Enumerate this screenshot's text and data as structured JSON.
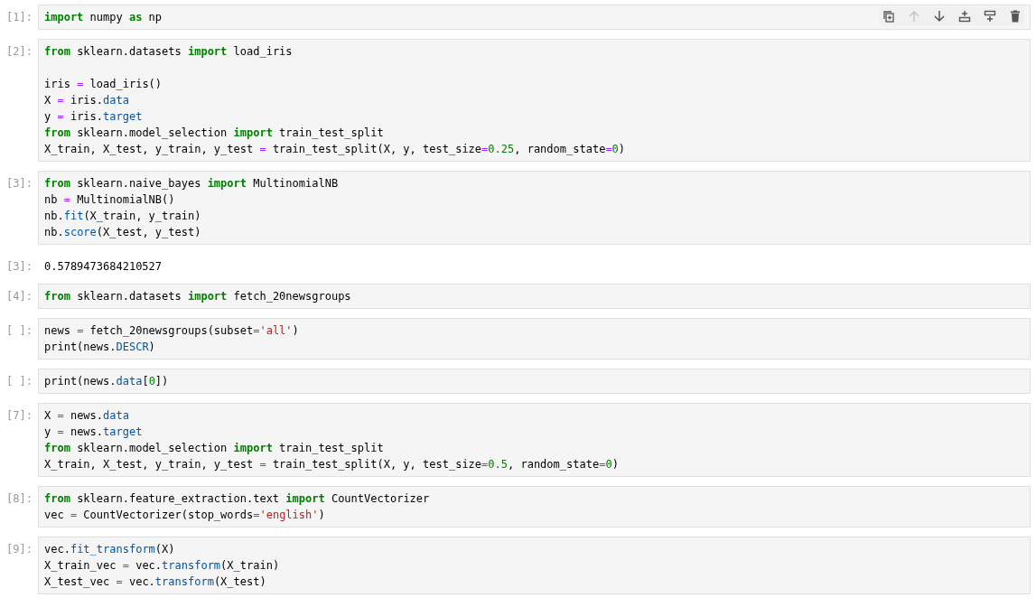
{
  "cell_toolbar": [
    {
      "kind": "duplicate",
      "disabled": false
    },
    {
      "kind": "up",
      "disabled": true
    },
    {
      "kind": "down",
      "disabled": false
    },
    {
      "kind": "insert_above",
      "disabled": false
    },
    {
      "kind": "insert_below",
      "disabled": false
    },
    {
      "kind": "delete",
      "disabled": false
    }
  ],
  "cells": [
    {
      "prompt": "[1]:",
      "selected": true,
      "lines": [
        {
          "tokens": [
            {
              "t": "import",
              "kind": "kw"
            },
            {
              "t": " numpy "
            },
            {
              "t": "as",
              "kind": "kw"
            },
            {
              "t": " np"
            }
          ]
        }
      ]
    },
    {
      "prompt": "[2]:",
      "selected": false,
      "lines": [
        {
          "tokens": [
            {
              "t": "from",
              "kind": "kw"
            },
            {
              "t": " sklearn.datasets "
            },
            {
              "t": "import",
              "kind": "kw"
            },
            {
              "t": " load_iris"
            }
          ]
        },
        {
          "blank_before": true,
          "tokens": [
            {
              "t": "iris "
            },
            {
              "t": "=",
              "kind": "op"
            },
            {
              "t": " load_iris()"
            }
          ]
        },
        {
          "tokens": [
            {
              "t": "X "
            },
            {
              "t": "=",
              "kind": "op"
            },
            {
              "t": " iris."
            },
            {
              "t": "data",
              "kind": "attr"
            }
          ]
        },
        {
          "tokens": [
            {
              "t": "y "
            },
            {
              "t": "=",
              "kind": "op"
            },
            {
              "t": " iris."
            },
            {
              "t": "target",
              "kind": "attr"
            }
          ]
        },
        {
          "tokens": [
            {
              "t": "from",
              "kind": "kw"
            },
            {
              "t": " sklearn.model_selection "
            },
            {
              "t": "import",
              "kind": "kw"
            },
            {
              "t": " train_test_split"
            }
          ]
        },
        {
          "tokens": [
            {
              "t": "X_train, X_test, y_train, y_test "
            },
            {
              "t": "=",
              "kind": "op"
            },
            {
              "t": " train_test_split(X, y, test_size"
            },
            {
              "t": "=",
              "kind": "op"
            },
            {
              "t": "0.25",
              "kind": "num"
            },
            {
              "t": ", random_state"
            },
            {
              "t": "=",
              "kind": "op"
            },
            {
              "t": "0",
              "kind": "num"
            },
            {
              "t": ")"
            }
          ]
        }
      ]
    },
    {
      "prompt": "[3]:",
      "selected": false,
      "lines": [
        {
          "tokens": [
            {
              "t": "from",
              "kind": "kw"
            },
            {
              "t": " sklearn.naive_bayes "
            },
            {
              "t": "import",
              "kind": "kw"
            },
            {
              "t": " MultinomialNB"
            }
          ]
        },
        {
          "tokens": [
            {
              "t": "nb "
            },
            {
              "t": "=",
              "kind": "op"
            },
            {
              "t": " MultinomialNB()"
            }
          ]
        },
        {
          "tokens": [
            {
              "t": "nb."
            },
            {
              "t": "fit",
              "kind": "attr"
            },
            {
              "t": "(X_train, y_train)"
            }
          ]
        },
        {
          "tokens": [
            {
              "t": "nb."
            },
            {
              "t": "score",
              "kind": "attr"
            },
            {
              "t": "(X_test, y_test)"
            }
          ]
        }
      ],
      "output": {
        "prompt": "[3]:",
        "text": "0.5789473684210527"
      }
    },
    {
      "prompt": "[4]:",
      "selected": false,
      "lines": [
        {
          "tokens": [
            {
              "t": "from",
              "kind": "kw"
            },
            {
              "t": " sklearn.datasets "
            },
            {
              "t": "import",
              "kind": "kw"
            },
            {
              "t": " fetch_20newsgroups"
            }
          ]
        }
      ]
    },
    {
      "prompt": "[ ]:",
      "selected": false,
      "lines": [
        {
          "tokens": [
            {
              "t": "news "
            },
            {
              "t": "=",
              "kind": "op"
            },
            {
              "t": " fetch_20newsgroups(subset"
            },
            {
              "t": "=",
              "kind": "op"
            },
            {
              "t": "'all'",
              "kind": "str"
            },
            {
              "t": ")"
            }
          ]
        },
        {
          "tokens": [
            {
              "t": "print(news."
            },
            {
              "t": "DESCR",
              "kind": "attr"
            },
            {
              "t": ")"
            }
          ]
        }
      ]
    },
    {
      "prompt": "[ ]:",
      "selected": false,
      "lines": [
        {
          "tokens": [
            {
              "t": "print(news."
            },
            {
              "t": "data",
              "kind": "attr"
            },
            {
              "t": "["
            },
            {
              "t": "0",
              "kind": "num"
            },
            {
              "t": "])"
            }
          ]
        }
      ]
    },
    {
      "prompt": "[7]:",
      "selected": false,
      "lines": [
        {
          "tokens": [
            {
              "t": "X "
            },
            {
              "t": "=",
              "kind": "op"
            },
            {
              "t": " news."
            },
            {
              "t": "data",
              "kind": "attr"
            }
          ]
        },
        {
          "tokens": [
            {
              "t": "y "
            },
            {
              "t": "=",
              "kind": "op"
            },
            {
              "t": " news."
            },
            {
              "t": "target",
              "kind": "attr"
            }
          ]
        },
        {
          "tokens": [
            {
              "t": "from",
              "kind": "kw"
            },
            {
              "t": " sklearn.model_selection "
            },
            {
              "t": "import",
              "kind": "kw"
            },
            {
              "t": " train_test_split"
            }
          ]
        },
        {
          "tokens": [
            {
              "t": "X_train, X_test, y_train, y_test "
            },
            {
              "t": "=",
              "kind": "op"
            },
            {
              "t": " train_test_split(X, y, test_size"
            },
            {
              "t": "=",
              "kind": "op"
            },
            {
              "t": "0.5",
              "kind": "num"
            },
            {
              "t": ", random_state"
            },
            {
              "t": "=",
              "kind": "op"
            },
            {
              "t": "0",
              "kind": "num"
            },
            {
              "t": ")"
            }
          ]
        }
      ]
    },
    {
      "prompt": "[8]:",
      "selected": false,
      "lines": [
        {
          "tokens": [
            {
              "t": "from",
              "kind": "kw"
            },
            {
              "t": " sklearn.feature_extraction.text "
            },
            {
              "t": "import",
              "kind": "kw"
            },
            {
              "t": " CountVectorizer"
            }
          ]
        },
        {
          "tokens": [
            {
              "t": "vec "
            },
            {
              "t": "=",
              "kind": "op"
            },
            {
              "t": " CountVectorizer(stop_words"
            },
            {
              "t": "=",
              "kind": "op"
            },
            {
              "t": "'english'",
              "kind": "str"
            },
            {
              "t": ")"
            }
          ]
        }
      ]
    },
    {
      "prompt": "[9]:",
      "selected": false,
      "lines": [
        {
          "tokens": [
            {
              "t": "vec."
            },
            {
              "t": "fit_transform",
              "kind": "attr"
            },
            {
              "t": "(X)"
            }
          ]
        },
        {
          "tokens": [
            {
              "t": "X_train_vec "
            },
            {
              "t": "=",
              "kind": "op"
            },
            {
              "t": " vec."
            },
            {
              "t": "transform",
              "kind": "attr"
            },
            {
              "t": "(X_train)"
            }
          ]
        },
        {
          "tokens": [
            {
              "t": "X_test_vec "
            },
            {
              "t": "=",
              "kind": "op"
            },
            {
              "t": " vec."
            },
            {
              "t": "transform",
              "kind": "attr"
            },
            {
              "t": "(X_test)"
            }
          ]
        }
      ]
    }
  ]
}
